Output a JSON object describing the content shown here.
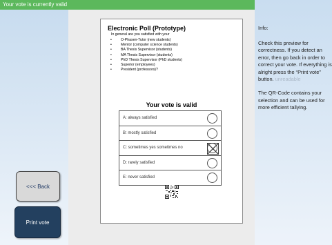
{
  "status": {
    "text": "Your vote is currently valid"
  },
  "buttons": {
    "back": "<<< Back",
    "print": "Print vote"
  },
  "poll": {
    "title": "Electronic Poll (Prototype)",
    "question": "In general are you satisfied with your",
    "roles": [
      "O-Phasen-Tutor (new students)",
      "Mentor (computer science students)",
      "BA Thesis Supervisor (students)",
      "MA Thesis Supervisor (students)",
      "PhD Thesis Supervisor (PhD students)",
      "Superior (employees)",
      "President (professors)?"
    ],
    "valid_heading": "Your vote is valid",
    "options": [
      {
        "label": "A: always satisfied",
        "selected": false
      },
      {
        "label": "B: mostly satisfied",
        "selected": false
      },
      {
        "label": "C: sometimes yes sometimes no",
        "selected": true
      },
      {
        "label": "D: rarely satisfied",
        "selected": false
      },
      {
        "label": "E: never satisfied",
        "selected": false
      }
    ]
  },
  "info": {
    "title": "Info:",
    "paragraph1": "Check this preview for correctness. If you detect an error, then go back in order to correct your vote. If everything is alright press the “Print vote” button.",
    "paragraph1_fade": "unreadable",
    "paragraph2": "The QR-Code contains your selection and can be used for more efficient tallying."
  },
  "colors": {
    "status_green": "#5cb85c",
    "print_button": "#23405f",
    "back_button": "#d9d9d9"
  }
}
